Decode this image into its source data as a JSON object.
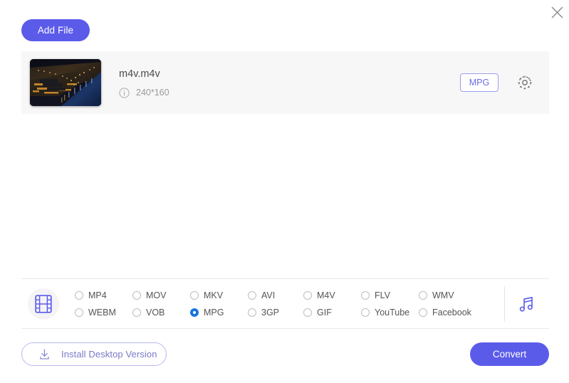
{
  "window": {
    "close_label": "close-icon"
  },
  "toolbar": {
    "add_file_label": "Add File"
  },
  "file_list": {
    "files": [
      {
        "name": "m4v.m4v",
        "info_icon": "info-icon",
        "resolution": "240*160",
        "output_format": "MPG",
        "settings_icon": "gear-icon",
        "thumbnail_alt": "night-cityscape-thumbnail"
      }
    ]
  },
  "format_bar": {
    "video_icon": "film-strip-icon",
    "audio_icon": "music-note-icon",
    "selected_format": "MPG",
    "options": [
      "MP4",
      "MOV",
      "MKV",
      "AVI",
      "M4V",
      "FLV",
      "WMV",
      "WEBM",
      "VOB",
      "MPG",
      "3GP",
      "GIF",
      "YouTube",
      "Facebook"
    ]
  },
  "footer": {
    "install_label": "Install Desktop Version",
    "install_icon": "download-icon",
    "convert_label": "Convert"
  },
  "colors": {
    "accent_purple": "#5b5bea",
    "badge_purple": "#6b6be4",
    "radio_blue": "#1677e0",
    "row_bg": "#f7f7f7",
    "divider": "#e8e8e8"
  }
}
